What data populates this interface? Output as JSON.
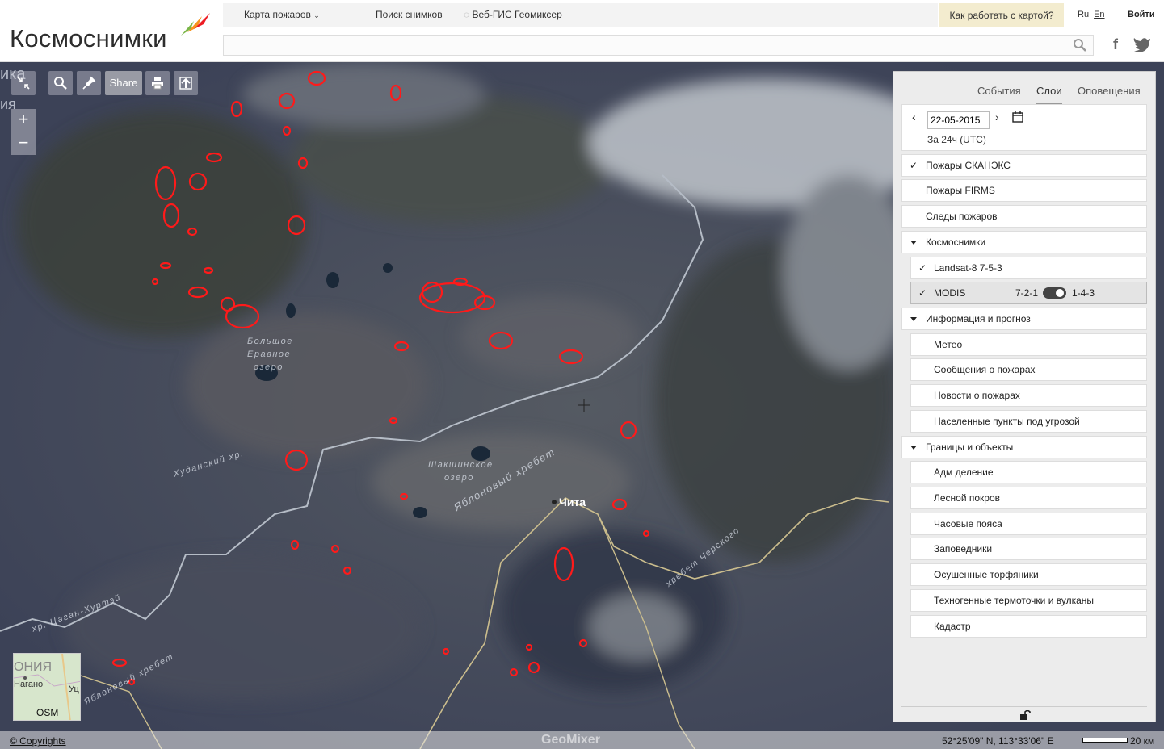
{
  "header": {
    "logo_text": "Космоснимки",
    "nav": {
      "fire_map": "Карта пожаров",
      "image_search": "Поиск снимков",
      "geomixer": "Веб-ГИС Геомиксер"
    },
    "howto": "Как работать с картой?",
    "lang_ru": "Ru",
    "lang_en": "En",
    "login": "Войти",
    "search_placeholder": "",
    "facebook": "f"
  },
  "map": {
    "share_label": "Share",
    "zoom_in": "+",
    "zoom_out": "−",
    "city_label": "Чита",
    "labels": {
      "lake_big1": "Большое",
      "lake_big2": "Еравное",
      "lake_big3": "озеро",
      "lake_shak1": "Шакшинское",
      "lake_shak2": "озеро",
      "hudan": "Худанский хр.",
      "yablon1": "Яблоновый хребет",
      "yablon2": "Яблоновый хребет",
      "chersk": "хребет Черского",
      "tsagan": "хр. Цаган-Хуртэй"
    },
    "corner_text1": "ика",
    "corner_text2": "ия",
    "minimap": {
      "text1": "ОНИЯ",
      "text2": "Нагано",
      "text3": "Уц",
      "label": "OSM"
    }
  },
  "footer": {
    "copyright": "© Copyrights",
    "logo": "GeoMixer",
    "coords": "52°25'09\" N, 113°33'06\" E",
    "scale": "20 км"
  },
  "panel": {
    "tabs": {
      "events": "События",
      "layers": "Слои",
      "alerts": "Оповещения"
    },
    "date": "22-05-2015",
    "period": "За 24ч (UTC)",
    "rows": {
      "fires_scanex": "Пожары СКАНЭКС",
      "fires_firms": "Пожары FIRMS",
      "fire_traces": "Следы пожаров",
      "kosmosnimki": "Космоснимки",
      "landsat": "Landsat-8 7-5-3",
      "modis": "MODIS",
      "modis_a": "7-2-1",
      "modis_b": "1-4-3",
      "info": "Информация и прогноз",
      "meteo": "Метео",
      "fire_reports": "Сообщения о пожарах",
      "fire_news": "Новости о пожарах",
      "settlements": "Населенные пункты под угрозой",
      "borders": "Границы и объекты",
      "adm": "Адм деление",
      "forest": "Лесной покров",
      "timezones": "Часовые пояса",
      "reserves": "Заповедники",
      "peat": "Осушенные торфяники",
      "thermal": "Техногенные термоточки и вулканы",
      "cadastre": "Кадастр"
    },
    "check": "✓"
  },
  "colors": {
    "fire": "#ff1a1a",
    "accent": "#f3eccf"
  }
}
